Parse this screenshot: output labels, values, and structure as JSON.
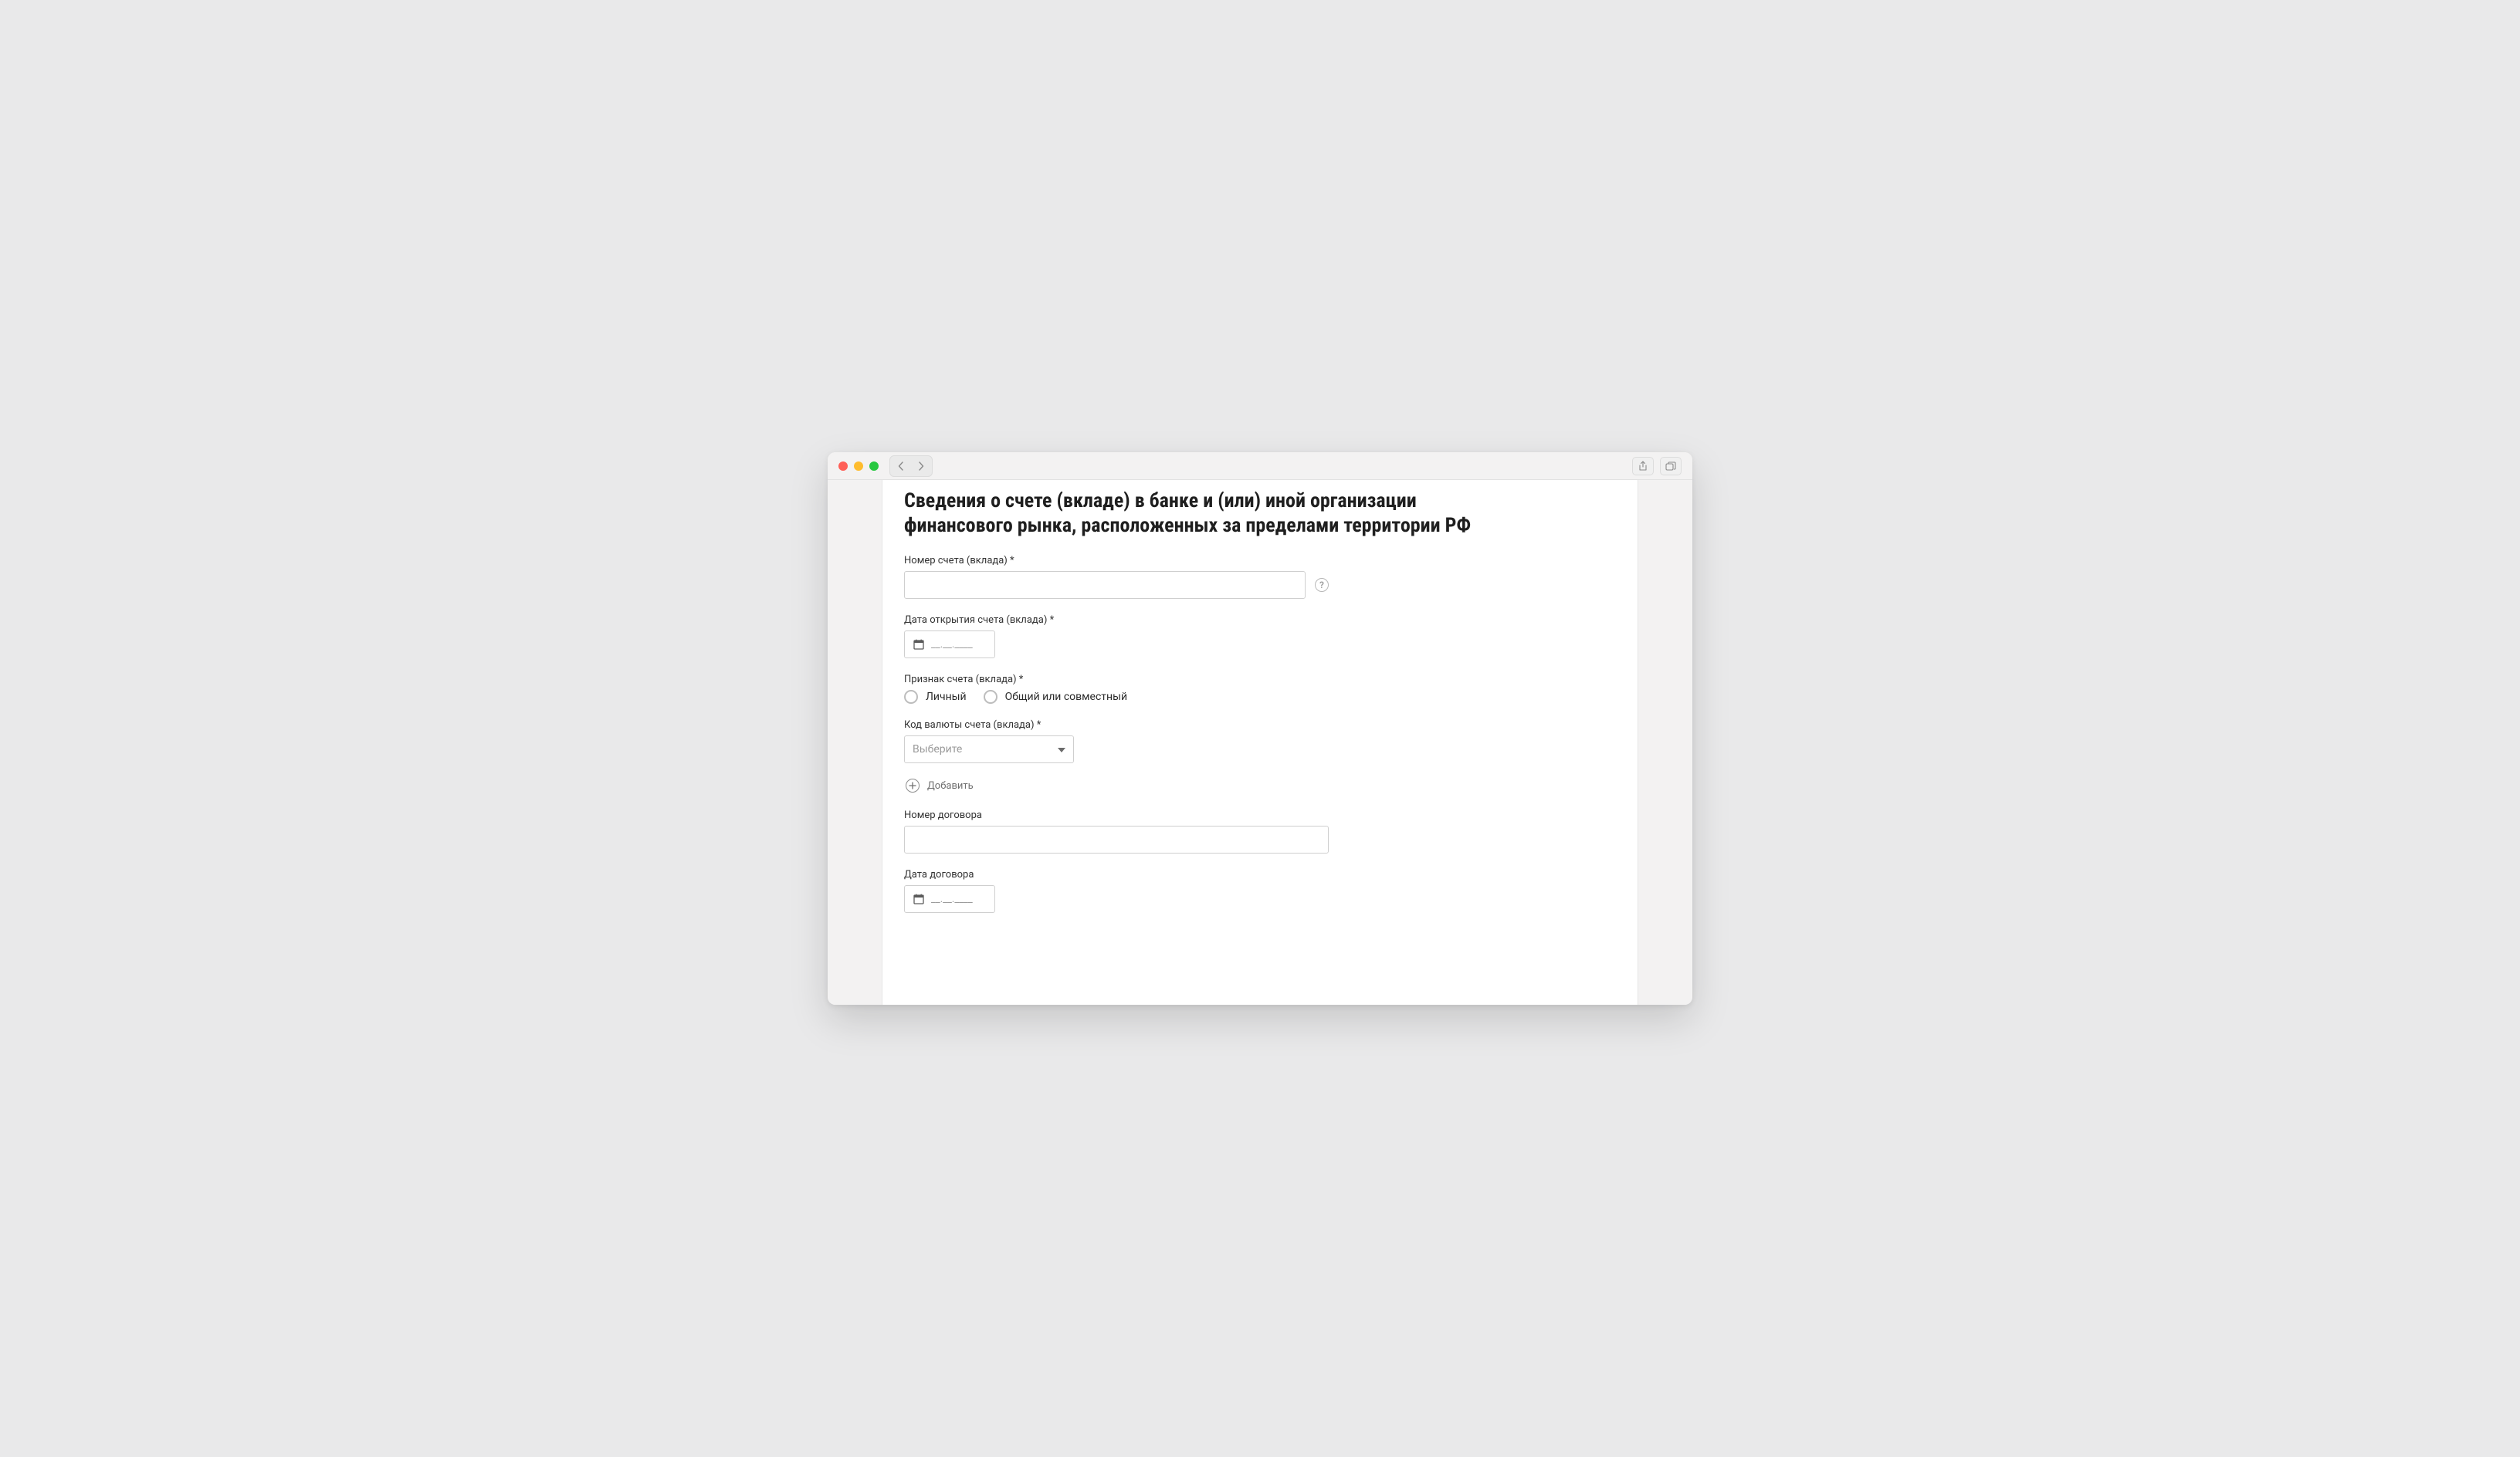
{
  "form": {
    "title": "Сведения о счете (вкладе) в банке и (или) иной организации финансового рынка, расположенных за пределами территории РФ",
    "account_number": {
      "label": "Номер счета (вклада) *",
      "value": ""
    },
    "open_date": {
      "label": "Дата открытия счета (вклада) *",
      "placeholder": "__.__.____"
    },
    "account_type": {
      "label": "Признак счета (вклада) *",
      "options": [
        {
          "label": "Личный"
        },
        {
          "label": "Общий или совместный"
        }
      ]
    },
    "currency": {
      "label": "Код валюты счета (вклада) *",
      "placeholder": "Выберите"
    },
    "add_label": "Добавить",
    "contract_number": {
      "label": "Номер договора",
      "value": ""
    },
    "contract_date": {
      "label": "Дата договора",
      "placeholder": "__.__.____"
    }
  }
}
